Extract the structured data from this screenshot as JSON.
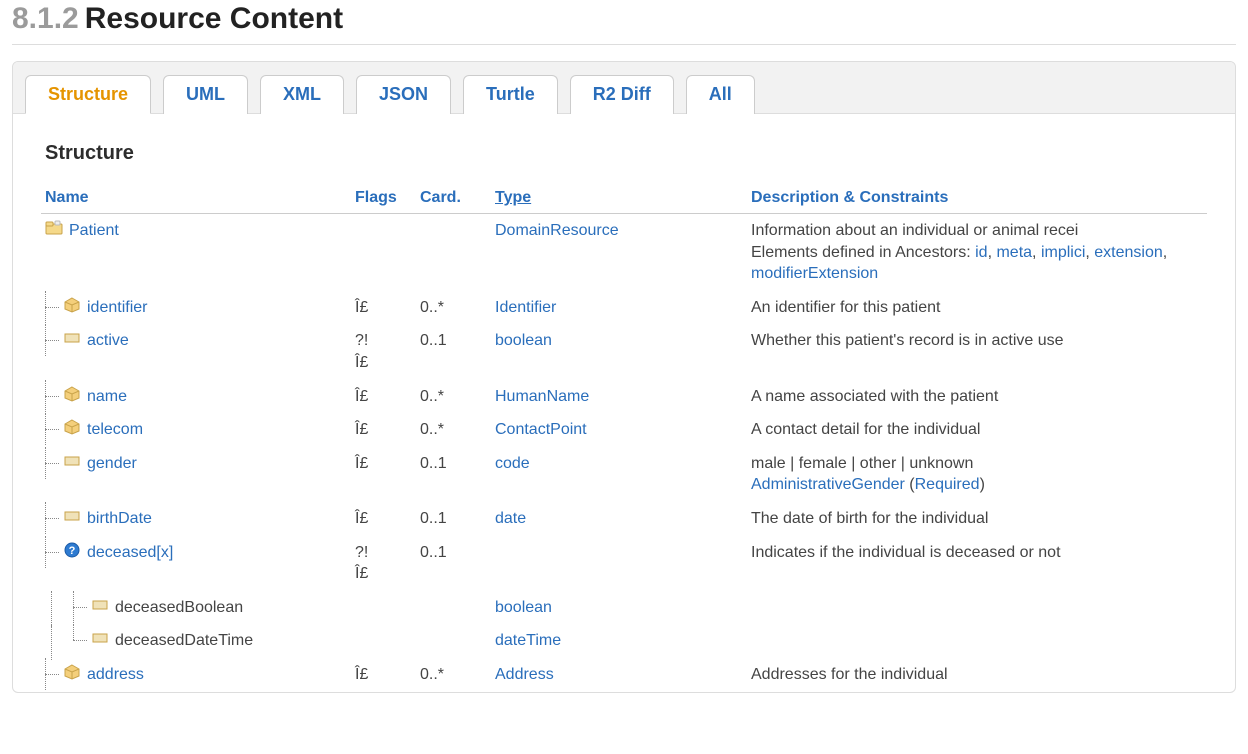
{
  "header": {
    "number": "8.1.2",
    "title": "Resource Content"
  },
  "tabs": [
    {
      "label": "Structure",
      "active": true
    },
    {
      "label": "UML"
    },
    {
      "label": "XML"
    },
    {
      "label": "JSON"
    },
    {
      "label": "Turtle"
    },
    {
      "label": "R2 Diff"
    },
    {
      "label": "All"
    }
  ],
  "subheading": "Structure",
  "columns": {
    "name": "Name",
    "flags": "Flags",
    "card": "Card.",
    "type": "Type",
    "desc": "Description & Constraints"
  },
  "rows": [
    {
      "depth": 0,
      "last": false,
      "icon": "folder",
      "nameClass": "link",
      "name": "Patient",
      "flags": [],
      "card": "",
      "type": "DomainResource",
      "typeClass": "link",
      "desc": {
        "line1": "Information about an individual or animal recei",
        "line2_prefix": "Elements defined in Ancestors: ",
        "ancestors": [
          "id",
          "meta",
          "implici",
          "extension",
          "modifierExtension"
        ]
      }
    },
    {
      "depth": 1,
      "last": false,
      "icon": "box",
      "nameClass": "link",
      "name": "identifier",
      "flags": [
        "Î£"
      ],
      "card": "0..*",
      "type": "Identifier",
      "typeClass": "link",
      "desc": {
        "text": "An identifier for this patient"
      }
    },
    {
      "depth": 1,
      "last": false,
      "icon": "prim",
      "nameClass": "link",
      "name": "active",
      "flags": [
        "?!",
        "Î£"
      ],
      "card": "0..1",
      "type": "boolean",
      "typeClass": "link",
      "desc": {
        "text": "Whether this patient's record is in active use"
      }
    },
    {
      "depth": 1,
      "last": false,
      "icon": "box",
      "nameClass": "link",
      "name": "name",
      "flags": [
        "Î£"
      ],
      "card": "0..*",
      "type": "HumanName",
      "typeClass": "link",
      "desc": {
        "text": "A name associated with the patient"
      }
    },
    {
      "depth": 1,
      "last": false,
      "icon": "box",
      "nameClass": "link",
      "name": "telecom",
      "flags": [
        "Î£"
      ],
      "card": "0..*",
      "type": "ContactPoint",
      "typeClass": "link",
      "desc": {
        "text": "A contact detail for the individual"
      }
    },
    {
      "depth": 1,
      "last": false,
      "icon": "prim",
      "nameClass": "link",
      "name": "gender",
      "flags": [
        "Î£"
      ],
      "card": "0..1",
      "type": "code",
      "typeClass": "link",
      "desc": {
        "text": "male | female | other | unknown",
        "binding": {
          "valueset": "AdministrativeGender",
          "strength": "Required"
        }
      }
    },
    {
      "depth": 1,
      "last": false,
      "icon": "prim",
      "nameClass": "link",
      "name": "birthDate",
      "flags": [
        "Î£"
      ],
      "card": "0..1",
      "type": "date",
      "typeClass": "link",
      "desc": {
        "text": "The date of birth for the individual"
      }
    },
    {
      "depth": 1,
      "last": false,
      "icon": "choice",
      "nameClass": "link",
      "name": "deceased[x]",
      "flags": [
        "?!",
        "Î£"
      ],
      "card": "0..1",
      "type": "",
      "typeClass": "",
      "desc": {
        "text": "Indicates if the individual is deceased or not"
      }
    },
    {
      "depth": 2,
      "last": false,
      "icon": "prim",
      "nameClass": "plain",
      "name": "deceasedBoolean",
      "flags": [],
      "card": "",
      "type": "boolean",
      "typeClass": "link",
      "desc": {}
    },
    {
      "depth": 2,
      "last": true,
      "icon": "prim",
      "nameClass": "plain",
      "name": "deceasedDateTime",
      "flags": [],
      "card": "",
      "type": "dateTime",
      "typeClass": "link",
      "desc": {}
    },
    {
      "depth": 1,
      "last": false,
      "icon": "box",
      "nameClass": "link",
      "name": "address",
      "flags": [
        "Î£"
      ],
      "card": "0..*",
      "type": "Address",
      "typeClass": "link",
      "desc": {
        "text": "Addresses for the individual"
      }
    }
  ]
}
